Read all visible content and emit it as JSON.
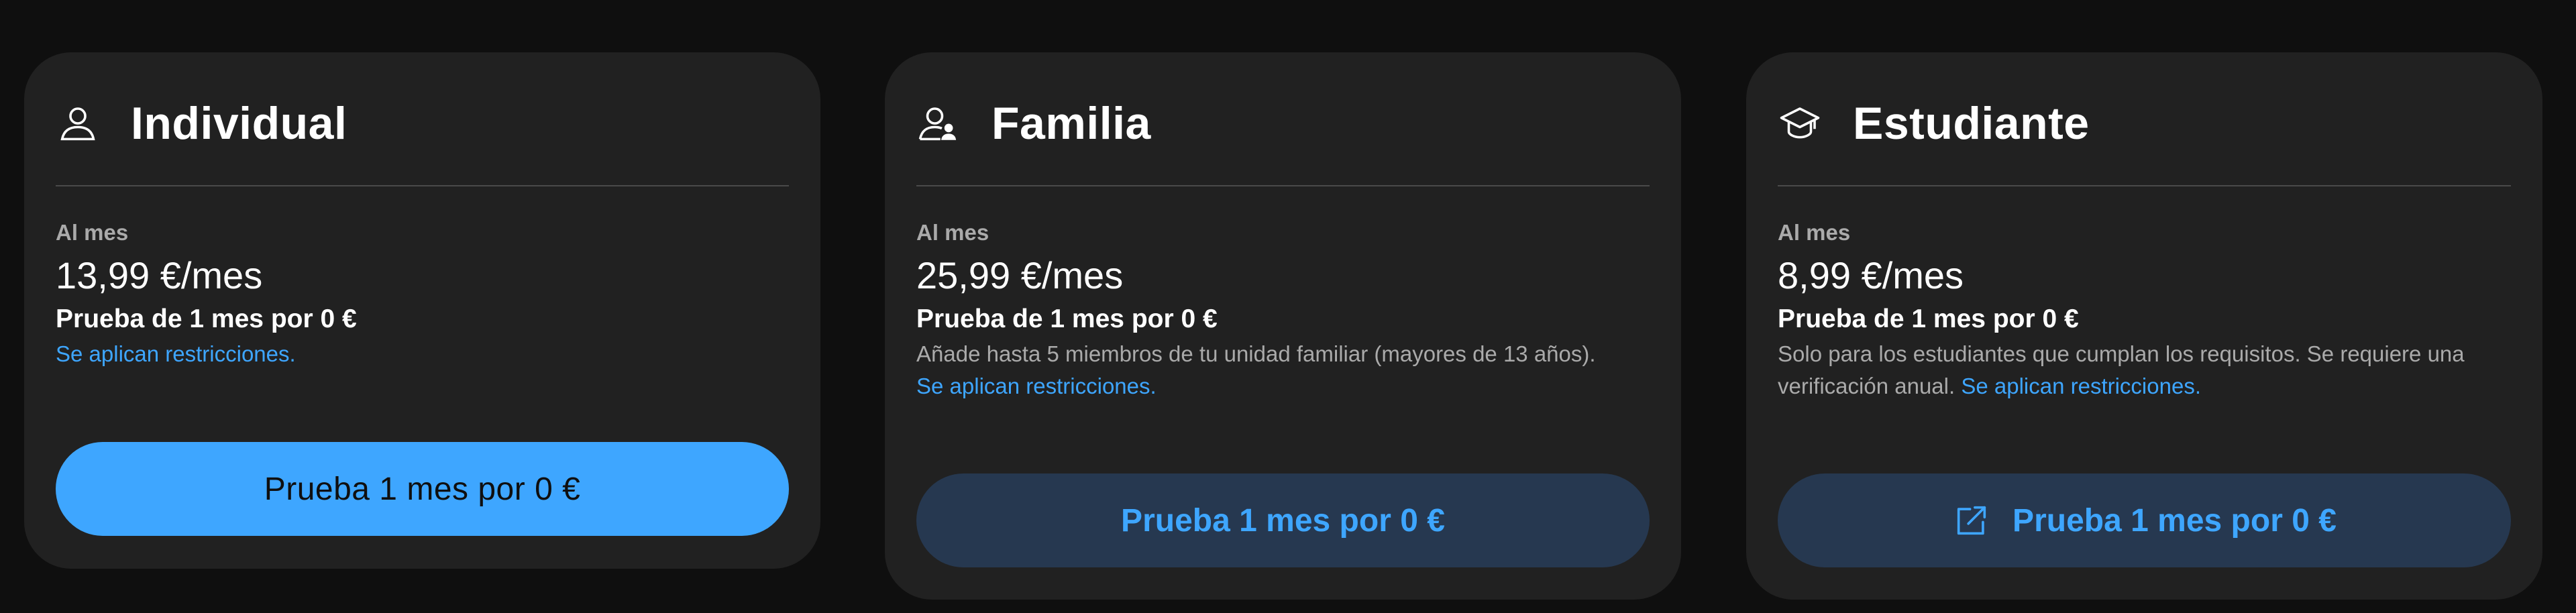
{
  "plans": [
    {
      "title": "Individual",
      "icon": "person-icon",
      "period": "Al mes",
      "price": "13,99 €/mes",
      "trial": "Prueba de 1 mes por 0 €",
      "description": "",
      "restrictions_link": "Se aplican restricciones.",
      "cta": "Prueba 1 mes por 0 €"
    },
    {
      "title": "Familia",
      "icon": "family-icon",
      "period": "Al mes",
      "price": "25,99 €/mes",
      "trial": "Prueba de 1 mes por 0 €",
      "description": "Añade hasta 5 miembros de tu unidad familiar (mayores de 13 años).",
      "restrictions_link": "Se aplican restricciones.",
      "cta": "Prueba 1 mes por 0 €"
    },
    {
      "title": "Estudiante",
      "icon": "graduation-cap-icon",
      "period": "Al mes",
      "price": "8,99 €/mes",
      "trial": "Prueba de 1 mes por 0 €",
      "description": "Solo para los estudiantes que cumplan los requisitos. Se requiere una verificación anual.",
      "restrictions_link": "Se aplican restricciones.",
      "cta": "Prueba 1 mes por 0 €",
      "cta_icon": "external-link-icon"
    }
  ],
  "colors": {
    "background": "#0f0f0f",
    "card": "#212121",
    "accent": "#3ea6ff",
    "secondary_button": "#263850",
    "muted_text": "#aaaaaa"
  }
}
